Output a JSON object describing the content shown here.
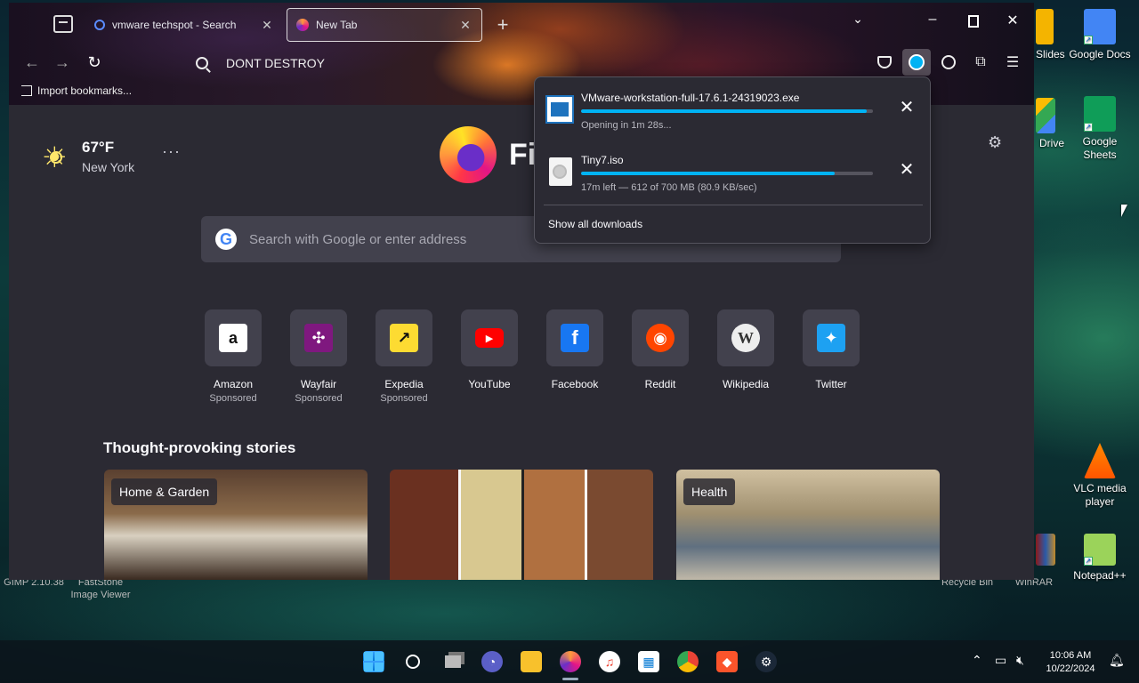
{
  "browser": {
    "tabs": [
      {
        "title": "vmware techspot - Search"
      },
      {
        "title": "New Tab"
      }
    ],
    "urlbar_text": "DONT DESTROY",
    "bookmarks_label": "Import bookmarks..."
  },
  "newtab": {
    "weather": {
      "temp": "67°F",
      "city": "New York"
    },
    "brand": "Fi",
    "search_placeholder": "Search with Google or enter address",
    "top_sites": [
      {
        "name": "Amazon",
        "sponsored": "Sponsored",
        "icon": "amazon-icon",
        "color": "#ffffff"
      },
      {
        "name": "Wayfair",
        "sponsored": "Sponsored",
        "icon": "wayfair-icon",
        "color": "#7f187f"
      },
      {
        "name": "Expedia",
        "sponsored": "Sponsored",
        "icon": "expedia-icon",
        "color": "#fddb32"
      },
      {
        "name": "YouTube",
        "sponsored": "",
        "icon": "youtube-icon",
        "color": "#ff0000"
      },
      {
        "name": "Facebook",
        "sponsored": "",
        "icon": "facebook-icon",
        "color": "#1877f2"
      },
      {
        "name": "Reddit",
        "sponsored": "",
        "icon": "reddit-icon",
        "color": "#ff4500"
      },
      {
        "name": "Wikipedia",
        "sponsored": "",
        "icon": "wikipedia-icon",
        "color": "#eeeeee"
      },
      {
        "name": "Twitter",
        "sponsored": "",
        "icon": "twitter-icon",
        "color": "#1da1f2"
      }
    ],
    "stories_title": "Thought-provoking stories",
    "stories": [
      {
        "tag": "Home & Garden"
      },
      {
        "tag": ""
      },
      {
        "tag": "Health"
      }
    ]
  },
  "downloads": {
    "items": [
      {
        "name": "VMware-workstation-full-17.6.1-24319023.exe",
        "status": "Opening in 1m 28s...",
        "progress": 0.98
      },
      {
        "name": "Tiny7.iso",
        "status": "17m left — 612 of 700 MB (80.9 KB/sec)",
        "progress": 0.87
      }
    ],
    "show_all": "Show all downloads"
  },
  "desktop": {
    "icons": [
      {
        "label": "Slides",
        "icon": "google-slides-icon"
      },
      {
        "label": "Google Docs",
        "icon": "google-docs-icon"
      },
      {
        "label": "Drive",
        "icon": "google-drive-icon"
      },
      {
        "label": "Google Sheets",
        "icon": "google-sheets-icon"
      },
      {
        "label": "VLC media player",
        "icon": "vlc-icon"
      },
      {
        "label": "Notepad++",
        "icon": "notepadpp-icon"
      }
    ],
    "behind_labels": [
      "GIMP 2.10.38",
      "FastStone Image Viewer",
      "Recycle Bin",
      "WinRAR"
    ]
  },
  "taskbar": {
    "time": "10:06 AM",
    "date": "10/22/2024"
  },
  "colors": {
    "accent": "#00b3f4",
    "page_bg": "#2b2a33"
  }
}
